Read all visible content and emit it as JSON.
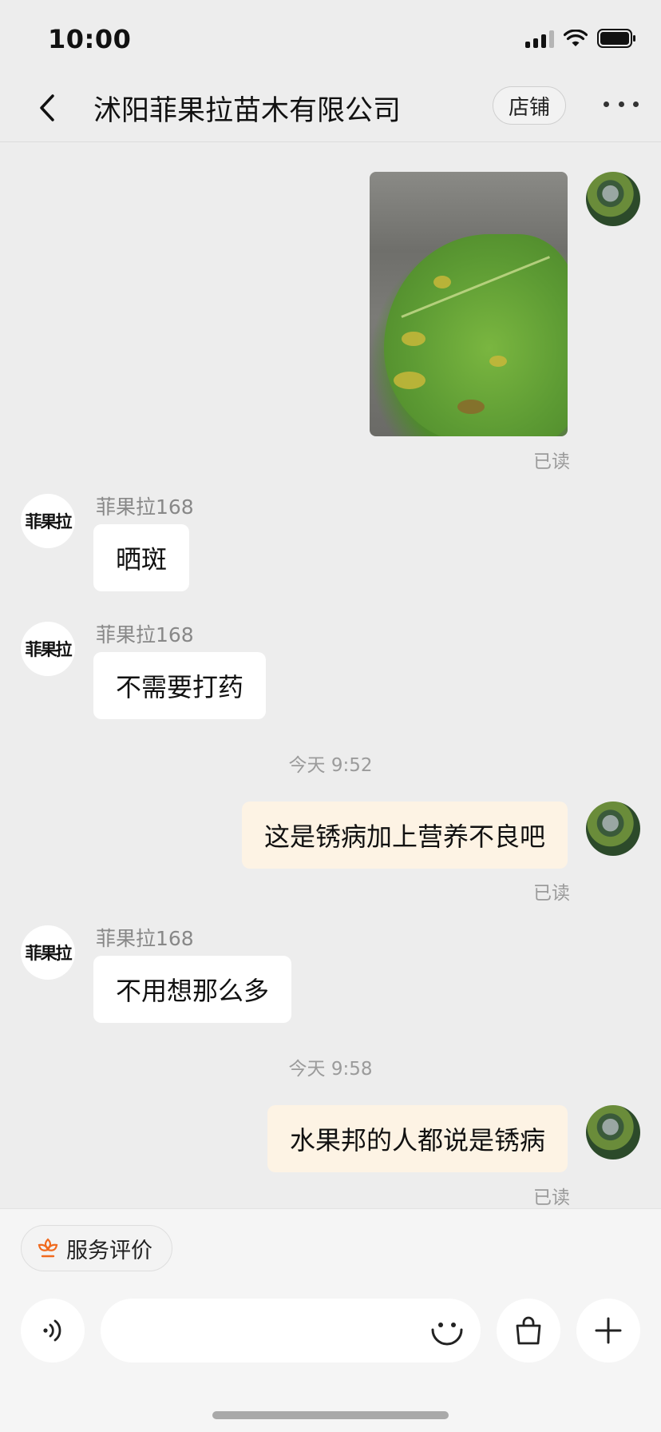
{
  "status_bar": {
    "time": "10:00"
  },
  "header": {
    "title": "沭阳菲果拉苗木有限公司",
    "shop_button": "店铺"
  },
  "shop_avatar_text": "菲果拉",
  "messages": [
    {
      "sender": "",
      "type": "image",
      "read": "已读"
    },
    {
      "sender": "菲果拉168",
      "text": "晒斑"
    },
    {
      "sender": "菲果拉168",
      "text": "不需要打药"
    },
    {
      "timestamp": "今天 9:52"
    },
    {
      "text": "这是锈病加上营养不良吧",
      "read": "已读"
    },
    {
      "sender": "菲果拉168",
      "text": "不用想那么多"
    },
    {
      "timestamp": "今天 9:58"
    },
    {
      "text": "水果邦的人都说是锈病",
      "read": "已读"
    }
  ],
  "footer": {
    "service_rating": "服务评价"
  },
  "colors": {
    "outgoing_bubble": "#fdf3e4",
    "incoming_bubble": "#ffffff",
    "accent": "#f06a1e",
    "background": "#ededed"
  },
  "icons": [
    "back-icon",
    "more-icon",
    "flower-icon",
    "voice-icon",
    "emoji-icon",
    "bag-icon",
    "plus-icon"
  ]
}
